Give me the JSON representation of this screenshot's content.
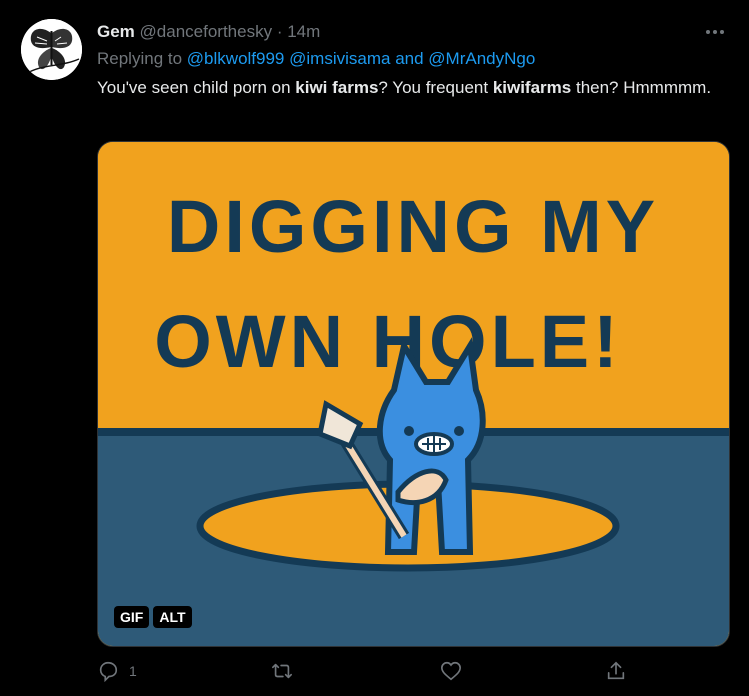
{
  "tweet": {
    "display_name": "Gem",
    "handle": "@danceforthesky",
    "separator": "·",
    "time": "14m",
    "replying_prefix": "Replying to",
    "replying_to_1": "@blkwolf999",
    "replying_to_2": "@imsivisama",
    "replying_and": "and",
    "replying_to_3": "@MrAndyNgo",
    "text_part1": "You've seen child porn on ",
    "text_bold1": "kiwi farms",
    "text_part2": "? You frequent ",
    "text_bold2": "kiwifarms",
    "text_part3": " then? Hmmmmm.",
    "media_line1": "DIGGING MY",
    "media_line2": "OWN HOLE!",
    "badge_gif": "GIF",
    "badge_alt": "ALT",
    "reply_count": "1"
  },
  "colors": {
    "background": "#000000",
    "link": "#1d9bf0",
    "muted": "#71767b",
    "gif_orange": "#f1a21e",
    "gif_floor": "#2e5a78",
    "gif_character": "#3b8fe0",
    "gif_ink": "#143a55"
  },
  "icons": [
    "more-icon",
    "reply-icon",
    "retweet-icon",
    "like-icon",
    "share-icon"
  ]
}
